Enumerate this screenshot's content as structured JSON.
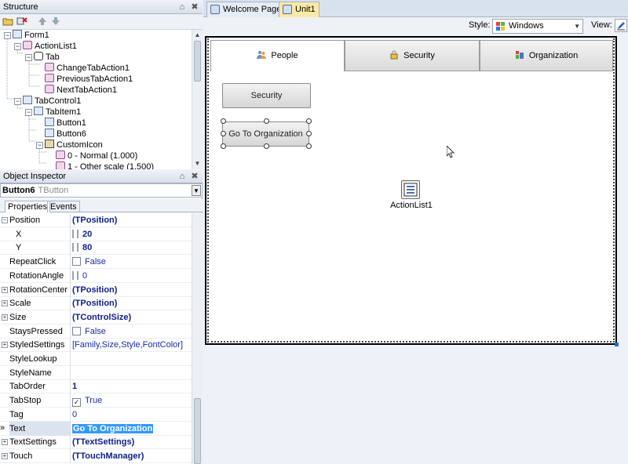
{
  "structure_panel": {
    "title": "Structure",
    "pin_glyph": "⌂",
    "close_glyph": "✖",
    "tree": [
      {
        "label": "Form1",
        "icon": "form-icon"
      },
      {
        "label": "ActionList1",
        "icon": "actionlist-icon"
      },
      {
        "label": "Tab",
        "icon": "category-icon"
      },
      {
        "label": "ChangeTabAction1",
        "icon": "action-icon"
      },
      {
        "label": "PreviousTabAction1",
        "icon": "action-icon"
      },
      {
        "label": "NextTabAction1",
        "icon": "action-icon"
      },
      {
        "label": "TabControl1",
        "icon": "tabcontrol-icon"
      },
      {
        "label": "TabItem1",
        "icon": "tabitem-icon"
      },
      {
        "label": "Button1",
        "icon": "button-icon"
      },
      {
        "label": "Button6",
        "icon": "button-icon"
      },
      {
        "label": "CustomIcon",
        "icon": "customicon-icon"
      },
      {
        "label": "0 - Normal (1.000)",
        "icon": "action-icon"
      },
      {
        "label": "1 - Other scale (1.500)",
        "icon": "action-icon"
      }
    ]
  },
  "object_inspector": {
    "title": "Object Inspector",
    "selected_name": "Button6",
    "selected_type": "TButton",
    "tabs": [
      "Properties",
      "Events"
    ],
    "properties": [
      {
        "name": "Position",
        "value": "(TPosition)",
        "style": "bold",
        "expand": "−"
      },
      {
        "name": "X",
        "value": "20",
        "style": "bold-spin",
        "indent": true
      },
      {
        "name": "Y",
        "value": "80",
        "style": "bold-spin",
        "indent": true
      },
      {
        "name": "RepeatClick",
        "value": "False",
        "style": "check"
      },
      {
        "name": "RotationAngle",
        "value": "0",
        "style": "spin"
      },
      {
        "name": "RotationCenter",
        "value": "(TPosition)",
        "style": "bold",
        "expand": "+"
      },
      {
        "name": "Scale",
        "value": "(TPosition)",
        "style": "bold",
        "expand": "+"
      },
      {
        "name": "Size",
        "value": "(TControlSize)",
        "style": "bold",
        "expand": "+"
      },
      {
        "name": "StaysPressed",
        "value": "False",
        "style": "check"
      },
      {
        "name": "StyledSettings",
        "value": "[Family,Size,Style,FontColor]",
        "style": "normal",
        "expand": "+"
      },
      {
        "name": "StyleLookup",
        "value": "",
        "style": "normal"
      },
      {
        "name": "StyleName",
        "value": "",
        "style": "normal"
      },
      {
        "name": "TabOrder",
        "value": "1",
        "style": "bold"
      },
      {
        "name": "TabStop",
        "value": "True",
        "style": "checked"
      },
      {
        "name": "Tag",
        "value": "0",
        "style": "normal"
      },
      {
        "name": "Text",
        "value": "Go To Organization",
        "style": "highlight",
        "marker": "»"
      },
      {
        "name": "TextSettings",
        "value": "(TTextSettings)",
        "style": "bold",
        "expand": "+"
      },
      {
        "name": "Touch",
        "value": "(TTouchManager)",
        "style": "bold",
        "expand": "+"
      }
    ]
  },
  "document_tabs": [
    {
      "label": "Welcome Page",
      "active": false
    },
    {
      "label": "Unit1",
      "active": true
    }
  ],
  "style_bar": {
    "style_label": "Style:",
    "style_value": "Windows",
    "view_label": "View:"
  },
  "designer": {
    "tabs": [
      {
        "label": "People",
        "icon": "people-icon",
        "active": true
      },
      {
        "label": "Security",
        "icon": "lock-icon",
        "active": false
      },
      {
        "label": "Organization",
        "icon": "organization-icon",
        "active": false
      }
    ],
    "buttons": [
      {
        "label": "Security"
      },
      {
        "label": "Go To Organization",
        "selected": true
      }
    ],
    "component_label": "ActionList1"
  },
  "colors": {
    "accent_highlight": "#3399ff",
    "active_doc_tab": "#fbe9a6",
    "property_value": "#1a2aa8"
  }
}
